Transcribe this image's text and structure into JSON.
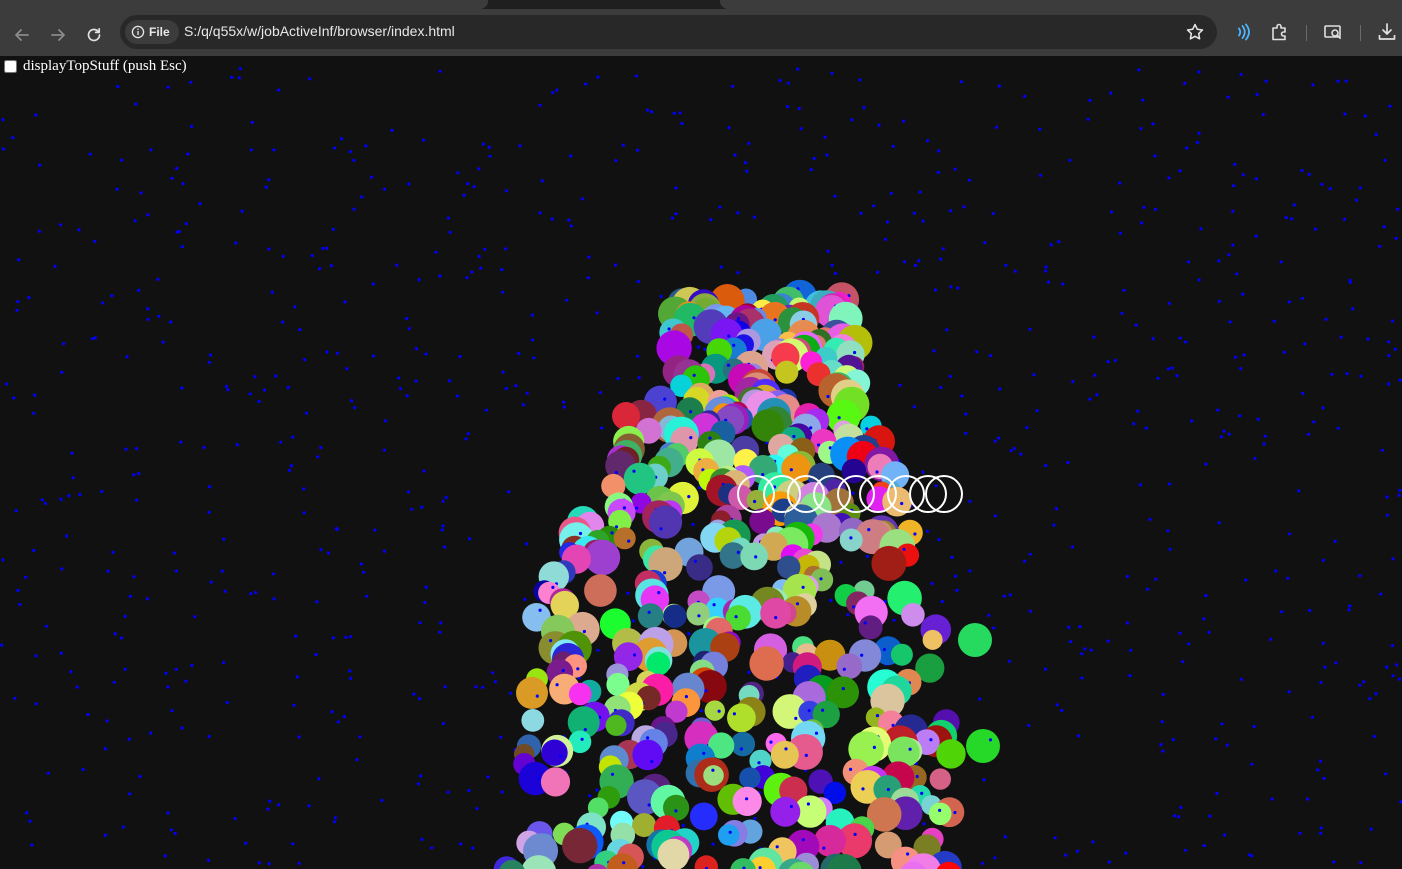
{
  "browser": {
    "site_chip_label": "File",
    "url": "S:/q/q55x/w/jobActiveInf/browser/index.html",
    "icons": {
      "back": "arrow-left-icon",
      "forward": "arrow-right-icon",
      "reload": "reload-icon",
      "site_info": "info-circle-icon",
      "bookmark": "star-icon",
      "read_aloud": "read-aloud-icon",
      "extensions": "puzzle-icon",
      "cast": "cast-search-icon",
      "downloads": "download-icon"
    },
    "colors": {
      "tabstrip": "#1f1f1f",
      "toolbar": "#3c3c3c",
      "omnibox": "#282828",
      "accent": "#4cb6ff"
    }
  },
  "page": {
    "checkbox_label": "displayTopStuff (push Esc)",
    "checkbox_checked": false,
    "background_color": "#111111",
    "particle_color": "#0000ff",
    "agent_ring_color": "#ffffff",
    "agent_ring_count": 9
  }
}
